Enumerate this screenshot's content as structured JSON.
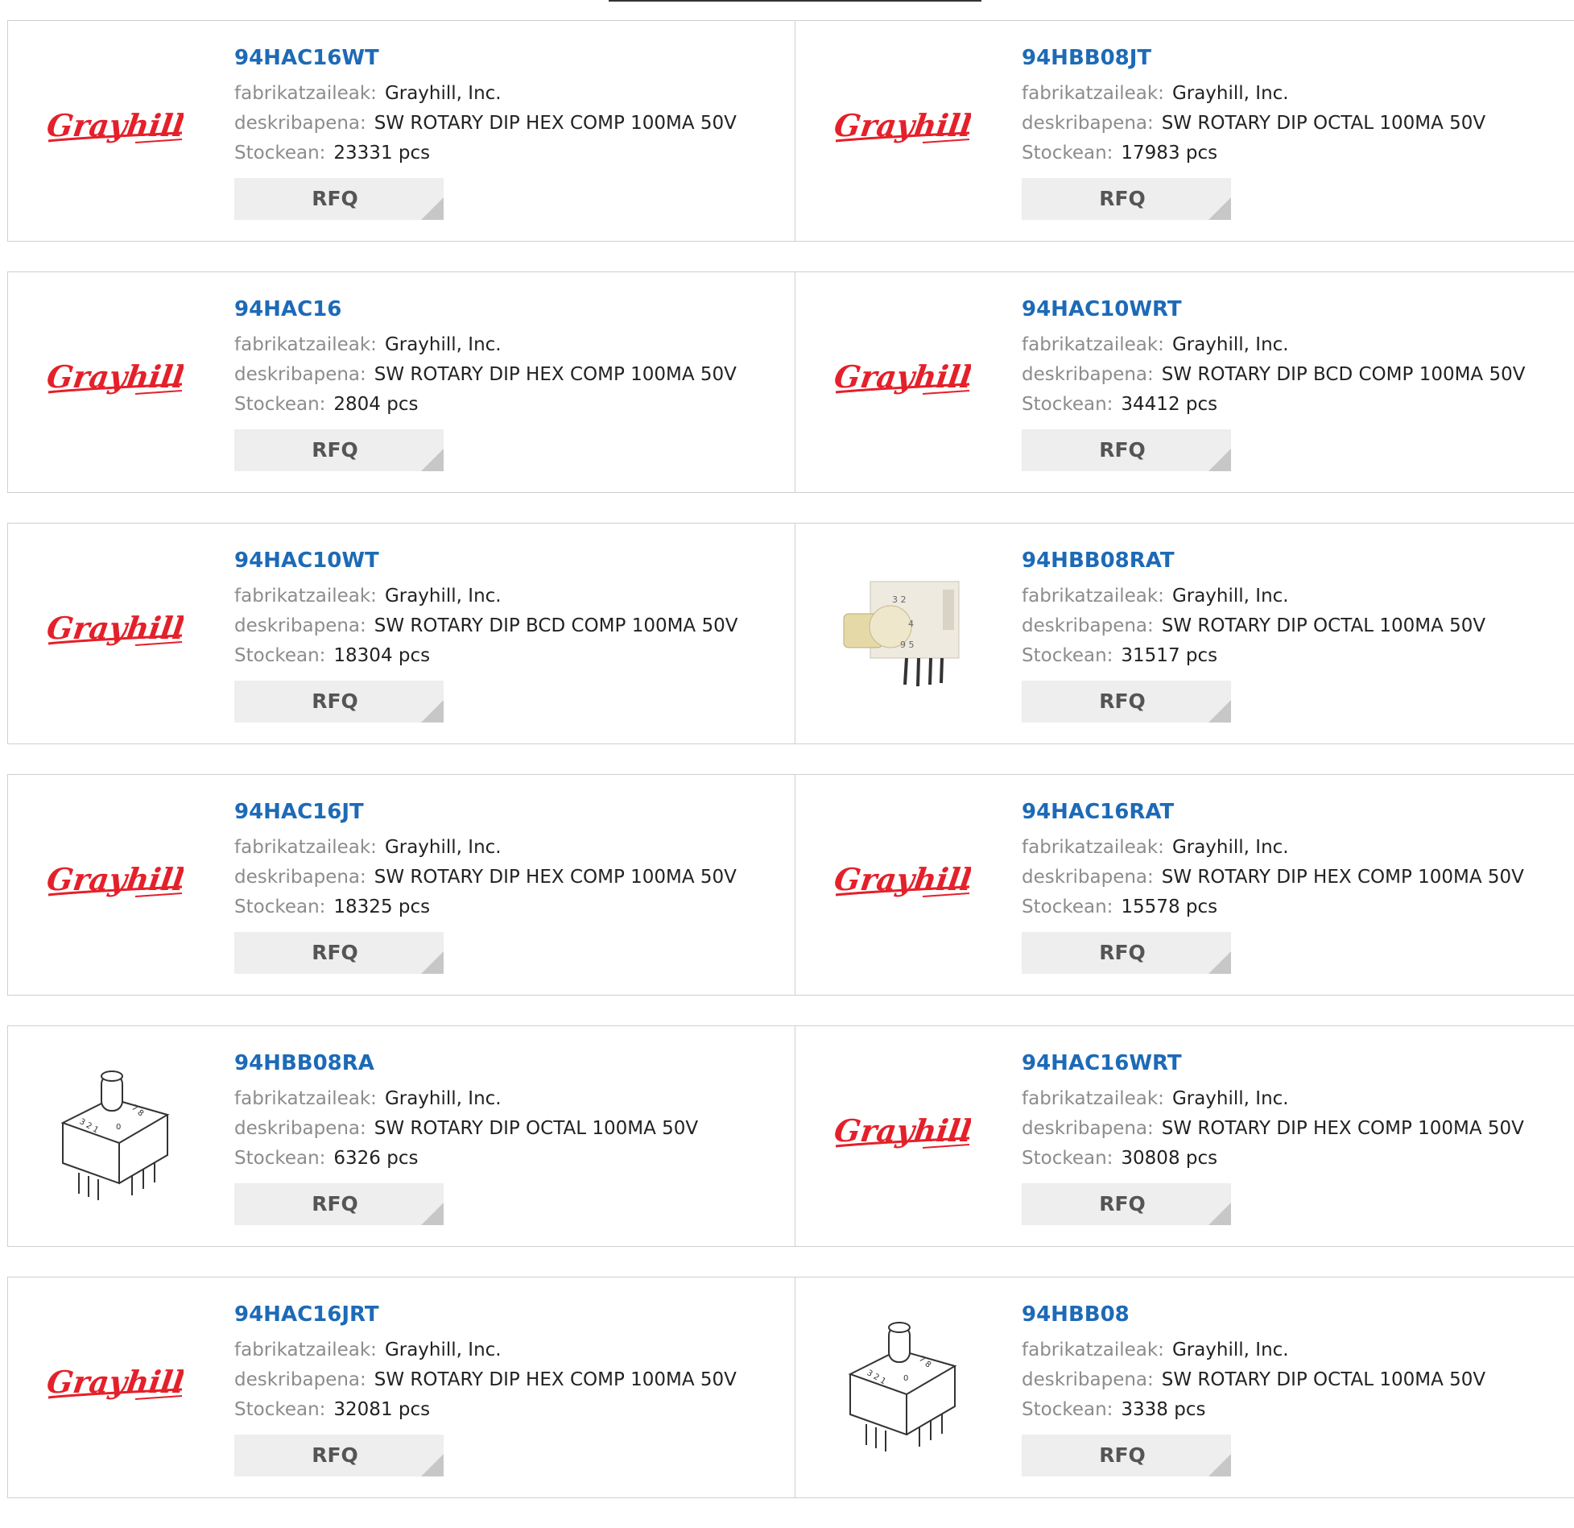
{
  "labels": {
    "manufacturer": "fabrikatzaileak:",
    "description": "deskribapena:",
    "stock": "Stockean:",
    "rfq": "RFQ"
  },
  "colors": {
    "part_link": "#1d6ab7",
    "logo_red": "#e4202a"
  },
  "rows": [
    [
      {
        "part": "94HAC16WT",
        "manufacturer": "Grayhill, Inc.",
        "description": "SW ROTARY DIP HEX COMP 100MA 50V",
        "stock": "23331 pcs",
        "image": "grayhill-logo"
      },
      {
        "part": "94HBB08JT",
        "manufacturer": "Grayhill, Inc.",
        "description": "SW ROTARY DIP OCTAL 100MA 50V",
        "stock": "17983 pcs",
        "image": "grayhill-logo"
      }
    ],
    [
      {
        "part": "94HAC16",
        "manufacturer": "Grayhill, Inc.",
        "description": "SW ROTARY DIP HEX COMP 100MA 50V",
        "stock": "2804 pcs",
        "image": "grayhill-logo"
      },
      {
        "part": "94HAC10WRT",
        "manufacturer": "Grayhill, Inc.",
        "description": "SW ROTARY DIP BCD COMP 100MA 50V",
        "stock": "34412 pcs",
        "image": "grayhill-logo"
      }
    ],
    [
      {
        "part": "94HAC10WT",
        "manufacturer": "Grayhill, Inc.",
        "description": "SW ROTARY DIP BCD COMP 100MA 50V",
        "stock": "18304 pcs",
        "image": "grayhill-logo"
      },
      {
        "part": "94HBB08RAT",
        "manufacturer": "Grayhill, Inc.",
        "description": "SW ROTARY DIP OCTAL 100MA 50V",
        "stock": "31517 pcs",
        "image": "rotary-switch-photo"
      }
    ],
    [
      {
        "part": "94HAC16JT",
        "manufacturer": "Grayhill, Inc.",
        "description": "SW ROTARY DIP HEX COMP 100MA 50V",
        "stock": "18325 pcs",
        "image": "grayhill-logo"
      },
      {
        "part": "94HAC16RAT",
        "manufacturer": "Grayhill, Inc.",
        "description": "SW ROTARY DIP HEX COMP 100MA 50V",
        "stock": "15578 pcs",
        "image": "grayhill-logo"
      }
    ],
    [
      {
        "part": "94HBB08RA",
        "manufacturer": "Grayhill, Inc.",
        "description": "SW ROTARY DIP OCTAL 100MA 50V",
        "stock": "6326 pcs",
        "image": "rotary-switch-drawing"
      },
      {
        "part": "94HAC16WRT",
        "manufacturer": "Grayhill, Inc.",
        "description": "SW ROTARY DIP HEX COMP 100MA 50V",
        "stock": "30808 pcs",
        "image": "grayhill-logo"
      }
    ],
    [
      {
        "part": "94HAC16JRT",
        "manufacturer": "Grayhill, Inc.",
        "description": "SW ROTARY DIP HEX COMP 100MA 50V",
        "stock": "32081 pcs",
        "image": "grayhill-logo"
      },
      {
        "part": "94HBB08",
        "manufacturer": "Grayhill, Inc.",
        "description": "SW ROTARY DIP OCTAL 100MA 50V",
        "stock": "3338 pcs",
        "image": "rotary-switch-drawing"
      }
    ]
  ]
}
